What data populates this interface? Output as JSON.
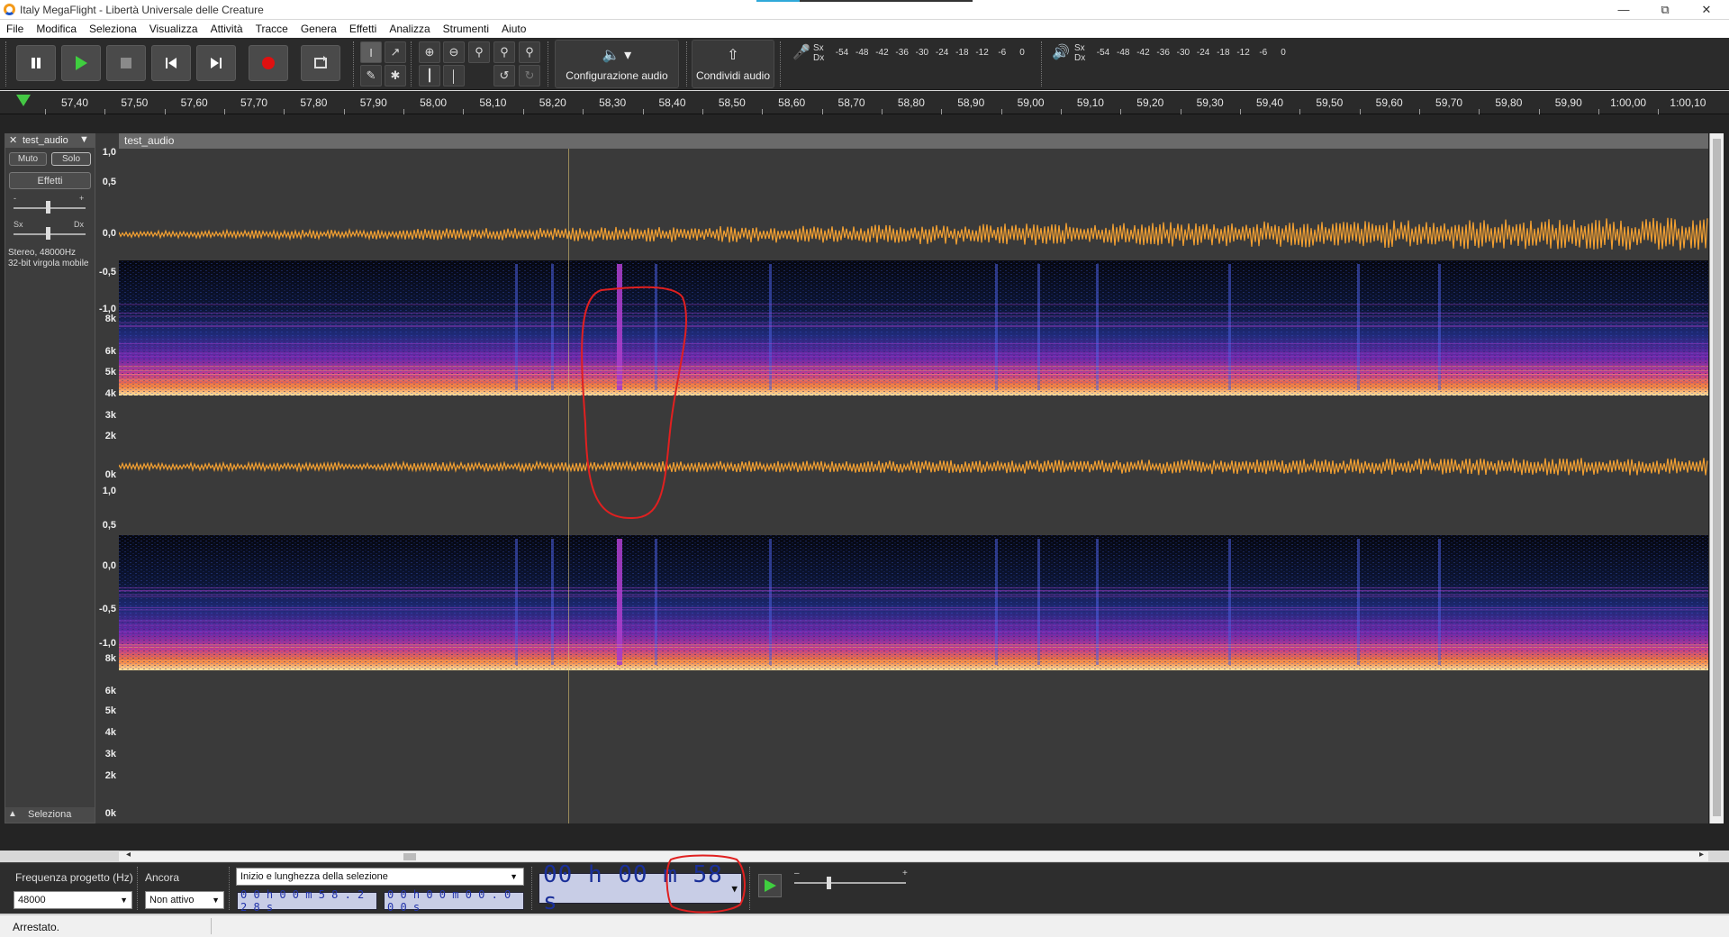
{
  "window": {
    "title": "Italy MegaFlight - Libertà Universale delle Creature",
    "minimize_icon": "minimize-icon",
    "restore_icon": "restore-icon",
    "close_icon": "close-icon"
  },
  "menu": [
    "File",
    "Modifica",
    "Seleziona",
    "Visualizza",
    "Attività",
    "Tracce",
    "Genera",
    "Effetti",
    "Analizza",
    "Strumenti",
    "Aiuto"
  ],
  "transport": {
    "buttons": [
      "pause-icon",
      "play-icon",
      "stop-icon",
      "skip-start-icon",
      "skip-end-icon",
      "record-icon",
      "loop-icon"
    ]
  },
  "tools": {
    "audio_setup_label": "Configurazione audio",
    "share_label": "Condividi audio"
  },
  "meters": {
    "record": {
      "left": "Sx",
      "right": "Dx",
      "scale": [
        "-54",
        "-48",
        "-42",
        "-36",
        "-30",
        "-24",
        "-18",
        "-12",
        "-6",
        "0"
      ]
    },
    "playback": {
      "left": "Sx",
      "right": "Dx",
      "scale": [
        "-54",
        "-48",
        "-42",
        "-36",
        "-30",
        "-24",
        "-18",
        "-12",
        "-6",
        "0"
      ]
    }
  },
  "ruler": {
    "ticks": [
      "57,40",
      "57,50",
      "57,60",
      "57,70",
      "57,80",
      "57,90",
      "58,00",
      "58,10",
      "58,20",
      "58,30",
      "58,40",
      "58,50",
      "58,60",
      "58,70",
      "58,80",
      "58,90",
      "59,00",
      "59,10",
      "59,20",
      "59,30",
      "59,40",
      "59,50",
      "59,60",
      "59,70",
      "59,80",
      "59,90",
      "1:00,00",
      "1:00,10"
    ]
  },
  "track": {
    "name": "test_audio",
    "mute": "Muto",
    "solo": "Solo",
    "effects": "Effetti",
    "gain_minus": "-",
    "gain_plus": "+",
    "pan_left": "Sx",
    "pan_right": "Dx",
    "info_line1": "Stereo, 48000Hz",
    "info_line2": "32-bit virgola mobile",
    "select": "Seleziona",
    "clip_name": "test_audio",
    "amp_labels": [
      "1,0",
      "0,5",
      "0,0",
      "-0,5",
      "-1,0"
    ],
    "freq_labels": [
      "8k",
      "6k",
      "5k",
      "4k",
      "3k",
      "2k",
      "0k"
    ]
  },
  "selection_bar": {
    "rate_label": "Frequenza progetto (Hz)",
    "rate_value": "48000",
    "snap_label": "Ancora",
    "snap_value": "Non attivo",
    "mode_value": "Inizio e lunghezza della selezione",
    "start_time": "0 0 h 0 0 m 5 8 . 2 2 8 s",
    "length_time": "0 0 h 0 0 m 0 0 . 0 0 0 s",
    "big_time": "00 h 00 m 58 s"
  },
  "status": {
    "text": "Arrestato."
  },
  "colors": {
    "waveform": "#f5a131",
    "annotation": "#e02020",
    "background": "#242424",
    "time_text": "#1a2f99"
  }
}
